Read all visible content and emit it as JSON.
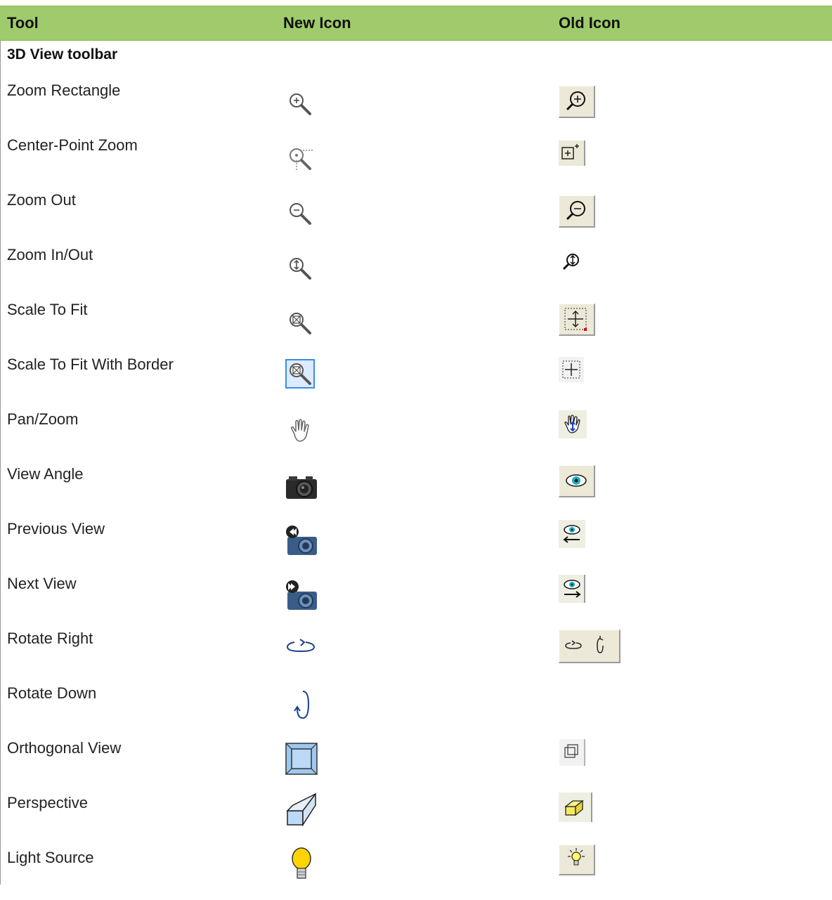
{
  "table": {
    "headers": [
      "Tool",
      "New Icon",
      "Old Icon"
    ],
    "section_title": "3D View toolbar",
    "rows": [
      {
        "label": "Zoom Rectangle",
        "new_icon": "zoom-plus-icon",
        "old_icon": "zoom-plus-button-icon"
      },
      {
        "label": "Center-Point Zoom",
        "new_icon": "center-point-zoom-icon",
        "old_icon": "center-point-zoom-button-icon"
      },
      {
        "label": "Zoom Out",
        "new_icon": "zoom-minus-icon",
        "old_icon": "zoom-minus-button-icon"
      },
      {
        "label": "Zoom In/Out",
        "new_icon": "zoom-in-out-icon",
        "old_icon": "zoom-in-out-button-icon"
      },
      {
        "label": "Scale To Fit",
        "new_icon": "scale-to-fit-icon",
        "old_icon": "scale-to-fit-button-icon"
      },
      {
        "label": "Scale To Fit With Border",
        "new_icon": "scale-to-fit-border-icon",
        "old_icon": "scale-to-fit-border-button-icon"
      },
      {
        "label": "Pan/Zoom",
        "new_icon": "hand-icon",
        "old_icon": "pan-zoom-button-icon"
      },
      {
        "label": "View Angle",
        "new_icon": "camera-icon",
        "old_icon": "eye-button-icon"
      },
      {
        "label": "Previous View",
        "new_icon": "camera-previous-icon",
        "old_icon": "eye-previous-button-icon"
      },
      {
        "label": "Next View",
        "new_icon": "camera-next-icon",
        "old_icon": "eye-next-button-icon"
      },
      {
        "label": "Rotate Right",
        "new_icon": "rotate-right-icon",
        "old_icon": "rotate-buttons-icon"
      },
      {
        "label": "Rotate Down",
        "new_icon": "rotate-down-icon",
        "old_icon": ""
      },
      {
        "label": "Orthogonal View",
        "new_icon": "orthogonal-cube-icon",
        "old_icon": "orthogonal-button-icon"
      },
      {
        "label": "Perspective",
        "new_icon": "perspective-box-icon",
        "old_icon": "perspective-button-icon"
      },
      {
        "label": "Light Source",
        "new_icon": "light-bulb-icon",
        "old_icon": "light-bulb-button-icon"
      }
    ]
  }
}
